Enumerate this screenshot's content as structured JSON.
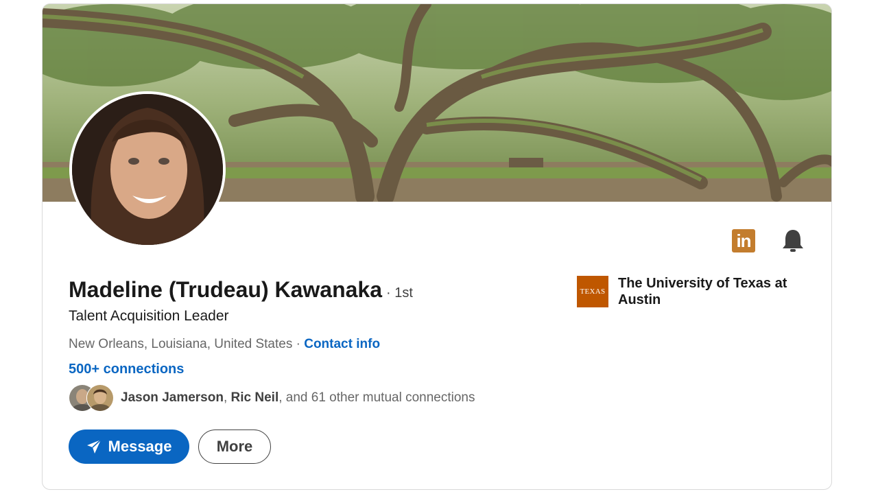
{
  "profile": {
    "name": "Madeline (Trudeau) Kawanaka",
    "degree": "· 1st",
    "headline": "Talent Acquisition Leader",
    "location": "New Orleans, Louisiana, United States",
    "location_sep": " · ",
    "contact_info": "Contact info",
    "connections": "500+ connections"
  },
  "mutual": {
    "first": "Jason Jamerson",
    "sep": ", ",
    "second": "Ric Neil",
    "rest": ", and 61 other mutual connections"
  },
  "actions": {
    "message": "Message",
    "more": "More"
  },
  "education": {
    "school_name": "The University of Texas at Austin",
    "logo_text": "TEXAS"
  },
  "icons": {
    "linkedin": "linkedin-icon",
    "bell": "bell-icon",
    "send": "send-icon"
  },
  "colors": {
    "accent": "#0a66c2",
    "linkedin_badge": "#c37d2e",
    "school_logo": "#bf5700"
  }
}
